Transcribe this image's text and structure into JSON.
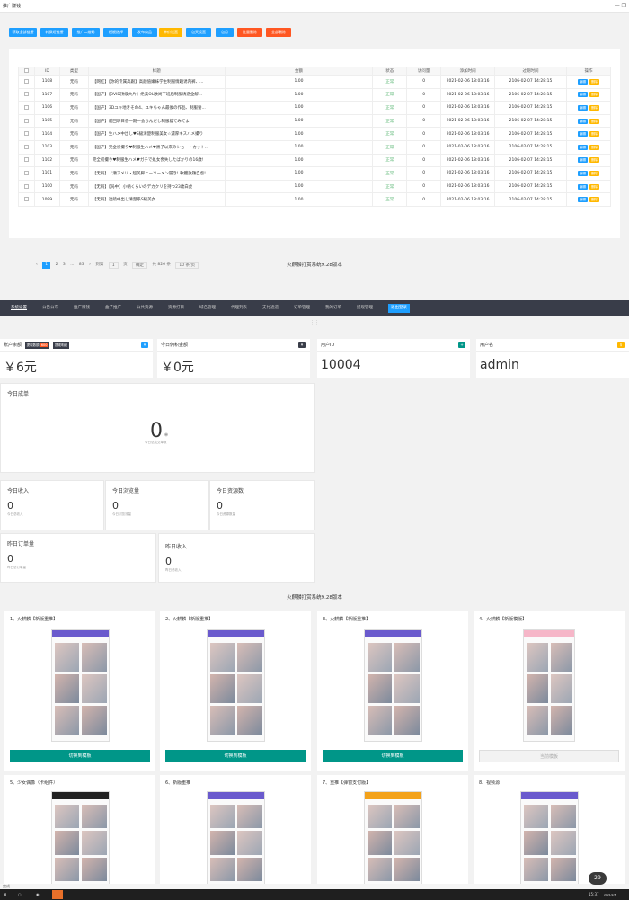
{
  "window": {
    "title": "推广赚钱",
    "controls": "— ❐"
  },
  "toolbar": {
    "buttons": [
      {
        "label": "获取全部链接",
        "color": "#1e9fff"
      },
      {
        "label": "转换短链接",
        "color": "#1e9fff"
      },
      {
        "label": "推广二维码",
        "color": "#1e9fff"
      },
      {
        "label": "模板选择",
        "color": "#1e9fff"
      },
      {
        "label": "发布商品",
        "color": "#1e9fff"
      },
      {
        "label": "单价设置",
        "color": "#ffb800"
      },
      {
        "label": "包天设置",
        "color": "#1e9fff"
      },
      {
        "label": "包月",
        "color": "#1e9fff"
      },
      {
        "label": "批量删除",
        "color": "#ff5722"
      },
      {
        "label": "全部删除",
        "color": "#ff5722"
      }
    ]
  },
  "table": {
    "headers": [
      "ID",
      "类型",
      "标题",
      "金额",
      "状态",
      "访问量",
      "添加时间",
      "过期时间",
      "操作"
    ],
    "rows": [
      {
        "id": "1108",
        "type": "无码",
        "title": "【网红】【你的专属高跟】高颜值嫩妹学生制服情趣诱内裤、...",
        "amount": "1.00",
        "status": "正常",
        "visits": "0",
        "added": "2021-02-06 18:03:16",
        "expires": "2106-02-07 14:28:15"
      },
      {
        "id": "1107",
        "type": "无码",
        "title": "【国产】【3VID顶级大片】绝美OL欧尚下班后制服诱惑全解...",
        "amount": "1.00",
        "status": "正常",
        "visits": "0",
        "added": "2021-02-06 18:03:16",
        "expires": "2106-02-07 14:28:15"
      },
      {
        "id": "1106",
        "type": "无码",
        "title": "【国产】3Dユキ地きその4、ユキちゃん最後の作品、制服誓...",
        "amount": "1.00",
        "status": "正常",
        "visits": "0",
        "added": "2021-02-06 18:03:16",
        "expires": "2106-02-07 14:28:15"
      },
      {
        "id": "1105",
        "type": "无码",
        "title": "【国产】前回明日香一期一会ちんだし制服着てみてよ!",
        "amount": "1.00",
        "status": "正常",
        "visits": "0",
        "added": "2021-02-06 18:03:16",
        "expires": "2106-02-07 14:28:15"
      },
      {
        "id": "1104",
        "type": "无码",
        "title": "【国产】生ハメ中出し♥S級清楚制服美女☆濃厚キスハメ撮り",
        "amount": "1.00",
        "status": "正常",
        "visits": "0",
        "added": "2021-02-06 18:03:16",
        "expires": "2106-02-07 14:28:15"
      },
      {
        "id": "1103",
        "type": "无码",
        "title": "【国产】完全初撮り♥制服生ハメ♥黒子以来のショートカット...",
        "amount": "1.00",
        "status": "正常",
        "visits": "0",
        "added": "2021-02-06 18:03:16",
        "expires": "2106-02-07 14:28:15"
      },
      {
        "id": "1102",
        "type": "无码",
        "title": "完全初撮り♥制服生ハメ♥ガチで処女喪失したばかりの16歳!",
        "amount": "1.00",
        "status": "正常",
        "visits": "0",
        "added": "2021-02-06 18:03:16",
        "expires": "2106-02-07 14:28:15"
      },
      {
        "id": "1101",
        "type": "无码",
        "title": "【无码】ノ瀬アメリ・超美脚ニーソーメン履き! 軟體放題自虐!",
        "amount": "1.00",
        "status": "正常",
        "visits": "0",
        "added": "2021-02-06 18:03:16",
        "expires": "2106-02-07 14:28:15"
      },
      {
        "id": "1100",
        "type": "无码",
        "title": "【无码】【局中】小柄くらいのデカクリを持つ23歳白虎",
        "amount": "1.00",
        "status": "正常",
        "visits": "0",
        "added": "2021-02-06 18:03:16",
        "expires": "2106-02-07 14:28:15"
      },
      {
        "id": "1099",
        "type": "无码",
        "title": "【无码】連続中出し清楚系S級美女",
        "amount": "1.00",
        "status": "正常",
        "visits": "0",
        "added": "2021-02-06 18:03:16",
        "expires": "2106-02-07 14:28:15"
      }
    ],
    "edit_label": "编辑",
    "del_label": "删除"
  },
  "pager": {
    "prev": "‹",
    "p1": "1",
    "p2": "2",
    "p3": "3",
    "ellipsis": "...",
    "last": "83",
    "next": "›",
    "goto": "到第",
    "page_value": "1",
    "page_unit": "页",
    "confirm": "确定",
    "total": "共 826 条",
    "size": "10 条/页"
  },
  "footer1": "火麒麟打赏系统9.28版本",
  "nav": {
    "items": [
      "系统设置",
      "公告公布",
      "推广赚钱",
      "盒子推广",
      "公共资源",
      "资源打目",
      "域名管理",
      "代理列表",
      "支付通道",
      "订单管理",
      "我的订单",
      "提现管理"
    ],
    "login": "退出登录"
  },
  "stats": {
    "balance": {
      "label": "账户余额",
      "tag": "¥",
      "value": "￥6元",
      "btn1": "提现数额",
      "btn1v": "600",
      "btn2": "提现明细"
    },
    "today_reward": {
      "label": "今日佣积金额",
      "tag": "¥",
      "value": "￥0元"
    },
    "uid": {
      "label": "用户ID",
      "tag": "+",
      "value": "10004"
    },
    "username": {
      "label": "用户名",
      "tag": "$",
      "value": "admin"
    }
  },
  "today_orders": {
    "label": "今日成单",
    "value": "0",
    "unit": "单",
    "sub": "今日总成交单数"
  },
  "mini_stats": [
    {
      "label": "今日收入",
      "value": "0",
      "sub": "今日总收入"
    },
    {
      "label": "今日浏览量",
      "value": "0",
      "sub": "今日浏览流量"
    },
    {
      "label": "今日资源数",
      "value": "0",
      "sub": "今日资源数量"
    },
    {
      "label": "昨日订单量",
      "value": "0",
      "sub": "昨日总订单量"
    },
    {
      "label": "昨日收入",
      "value": "0",
      "sub": "昨日总收入"
    }
  ],
  "footer2": "火麒麟打赏系统9.28版本",
  "templates": [
    {
      "title": "1、火麒麟【新版重推】",
      "btn": "切换到模板",
      "enabled": true
    },
    {
      "title": "2、火麒麟【新版重推】",
      "btn": "切换到模板",
      "enabled": true
    },
    {
      "title": "3、火麒麟【新版重推】",
      "btn": "切换到模板",
      "enabled": true
    },
    {
      "title": "4、火麒麟【新版模版】",
      "btn": "当前模板",
      "enabled": false
    },
    {
      "title": "5、少女偶像（卡组件）",
      "btn": "",
      "enabled": true
    },
    {
      "title": "6、新版重推",
      "btn": "",
      "enabled": true
    },
    {
      "title": "7、重推【弹窗支付版】",
      "btn": "",
      "enabled": true
    },
    {
      "title": "8、视频源",
      "btn": "",
      "enabled": true
    }
  ],
  "colors": {
    "primary": "#1e9fff",
    "teal": "#009688",
    "warn": "#ffb800",
    "danger": "#ff5722",
    "dark": "#393d49"
  },
  "taskbar": {
    "time": "15:37",
    "date": "2021/2/8",
    "badge": "29"
  },
  "download": "完成"
}
